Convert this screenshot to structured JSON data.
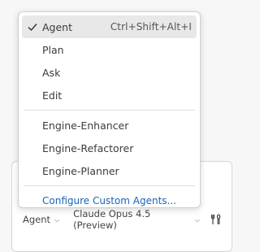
{
  "menu": {
    "modes": [
      {
        "label": "Agent",
        "shortcut": "Ctrl+Shift+Alt+I",
        "selected": true
      },
      {
        "label": "Plan"
      },
      {
        "label": "Ask"
      },
      {
        "label": "Edit"
      }
    ],
    "custom_agents": [
      {
        "label": "Engine-Enhancer"
      },
      {
        "label": "Engine-Refactorer"
      },
      {
        "label": "Engine-Planner"
      }
    ],
    "configure_label": "Configure Custom Agents..."
  },
  "toolbar": {
    "mode_label": "Agent",
    "model_label": "Claude Opus 4.5 (Preview)",
    "tools_icon": "tools-icon"
  },
  "colors": {
    "link": "#1a64b8",
    "selected_bg": "#e8e8e8"
  }
}
